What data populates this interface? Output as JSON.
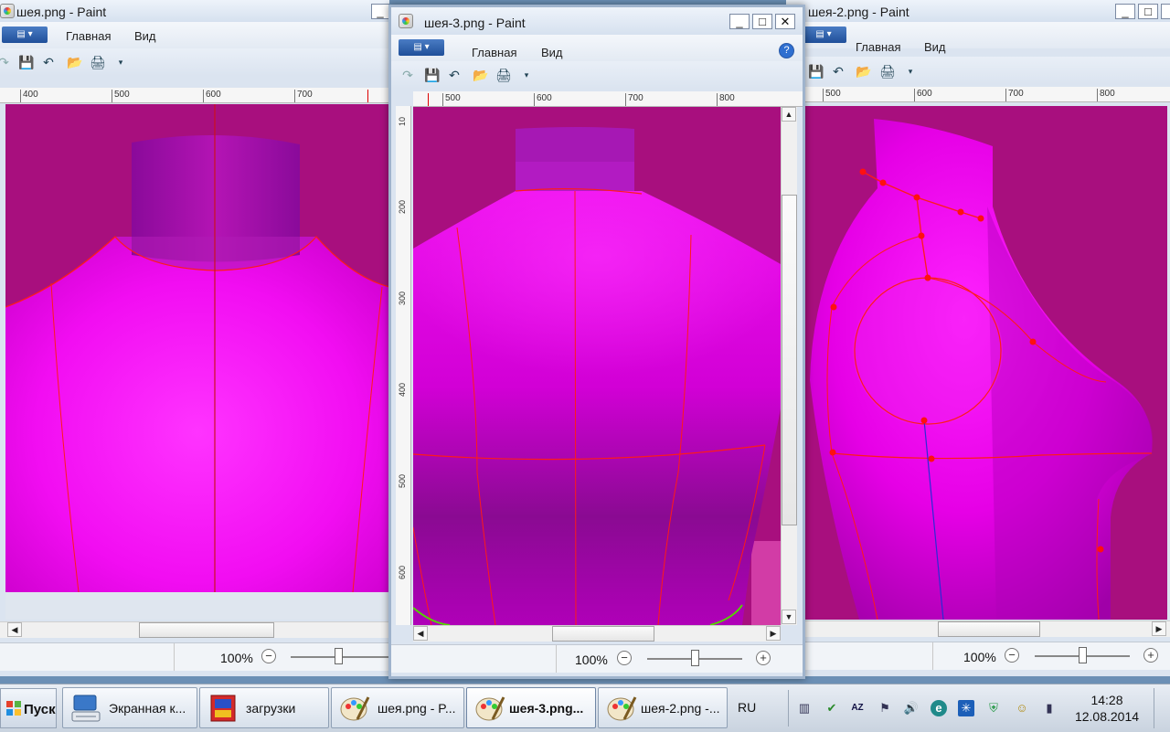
{
  "windows": {
    "left": {
      "title": "шея.png - Paint",
      "tabs": [
        "Главная",
        "Вид"
      ],
      "ruler_h": [
        "400",
        "500",
        "600",
        "700"
      ],
      "zoom": "100%"
    },
    "center": {
      "title": "шея-3.png - Paint",
      "tabs": [
        "Главная",
        "Вид"
      ],
      "ruler_h": [
        "500",
        "600",
        "700",
        "800"
      ],
      "ruler_v": [
        "10",
        "200",
        "300",
        "400",
        "500",
        "600"
      ],
      "zoom": "100%",
      "buttons": {
        "minimize": "_",
        "maximize": "□",
        "close": "✕"
      }
    },
    "right": {
      "title": "шея-2.png - Paint",
      "tabs": [
        "Главная",
        "Вид"
      ],
      "ruler_h": [
        "500",
        "600",
        "700",
        "800"
      ],
      "zoom": "100%"
    }
  },
  "taskbar": {
    "start": "Пуск",
    "items": [
      "Экранная к...",
      "загрузки",
      "шея.png - P...",
      "шея-3.png...",
      "шея-2.png -..."
    ],
    "lang": "RU",
    "time": "14:28",
    "date": "12.08.2014"
  },
  "icons": {
    "file_menu": "file-menu-icon",
    "save": "save-icon",
    "undo": "undo-icon",
    "redo": "redo-icon",
    "help": "help-icon"
  },
  "colors": {
    "canvas_background": "#a80f7e",
    "figure_magenta": "#e600e6",
    "pattern_lines": "#ff0000",
    "taskbar_bg": "#d6dee9"
  }
}
